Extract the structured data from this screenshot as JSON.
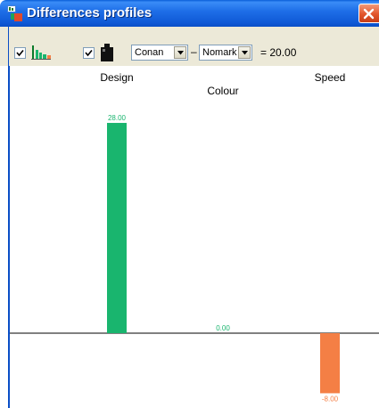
{
  "window": {
    "title": "Differences profiles"
  },
  "toolbar": {
    "profile_checkbox_checked": true,
    "weight_checkbox_checked": true,
    "product_a": "Conan",
    "operator": "–",
    "product_b": "Nomark",
    "result": "= 20.00"
  },
  "colors": {
    "positive_bar": "#19b56e",
    "negative_bar": "#f47f45",
    "axis": "#000000"
  },
  "chart_data": {
    "type": "bar",
    "categories": [
      "Design",
      "Colour",
      "Speed"
    ],
    "values": [
      28.0,
      0.0,
      -8.0
    ],
    "value_labels": [
      "28.00",
      "0.00",
      "-8.00"
    ],
    "title": "",
    "xlabel": "",
    "ylabel": "",
    "ylim": [
      -8,
      28
    ],
    "grid": false,
    "legend": "none"
  }
}
